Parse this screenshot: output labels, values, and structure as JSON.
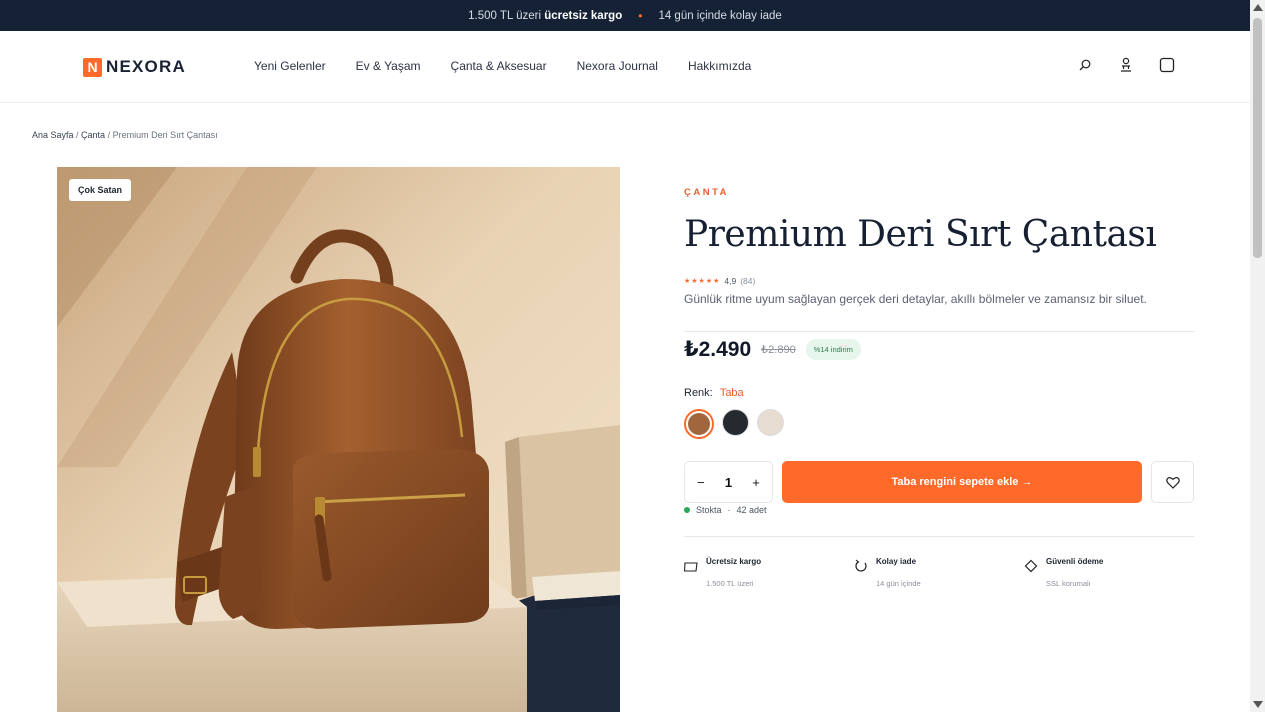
{
  "announcement": {
    "shipping_prefix": "1.500 TL üzeri",
    "shipping_bold": "ücretsiz kargo",
    "separator": "•",
    "returns": "14 gün içinde kolay iade"
  },
  "header": {
    "logo_mark": "N",
    "logo_text": "NEXORA",
    "nav": [
      "Yeni Gelenler",
      "Ev & Yaşam",
      "Çanta & Aksesuar",
      "Nexora Journal",
      "Hakkımızda"
    ],
    "icons": [
      "search-icon",
      "user-icon",
      "cart-icon"
    ]
  },
  "breadcrumb": {
    "home": "Ana Sayfa",
    "sep": " / ",
    "category": "Çanta",
    "current": "Premium Deri Sırt Çantası"
  },
  "media": {
    "badge": "Çok Satan"
  },
  "product": {
    "eyebrow": "ÇANTA",
    "title": "Premium Deri Sırt Çantası",
    "stars": "★★★★★",
    "rating": "4,9",
    "review_count": "(84)",
    "description": "Günlük ritme uyum sağlayan gerçek deri detaylar, akıllı bölmeler ve zamansız bir siluet.",
    "price": "₺2.490",
    "old_price": "₺2.890",
    "discount": "%14 indirim",
    "color_label": "Renk:",
    "color_value": "Taba",
    "swatches": [
      {
        "name": "Taba",
        "color": "#a0673f",
        "selected": true
      },
      {
        "name": "Siyah",
        "color": "#252a31",
        "selected": false
      },
      {
        "name": "Bej",
        "color": "#e6ddd0",
        "selected": false
      }
    ],
    "qty_minus": "−",
    "qty_value": "1",
    "qty_plus": "+",
    "add_to_cart": "Taba rengini sepete ekle →",
    "stock_status": "Stokta",
    "stock_sep": "·",
    "stock_count": "42 adet"
  },
  "features": [
    {
      "icon": "shipping-icon",
      "title": "Ücretsiz kargo",
      "sub": "1.500 TL üzeri"
    },
    {
      "icon": "return-icon",
      "title": "Kolay iade",
      "sub": "14 gün içinde"
    },
    {
      "icon": "secure-payment-icon",
      "title": "Güvenli ödeme",
      "sub": "SSL korumalı"
    }
  ],
  "colors": {
    "accent": "#ff6a2b",
    "announce_bg": "#152235",
    "in_stock": "#2fa65a"
  }
}
